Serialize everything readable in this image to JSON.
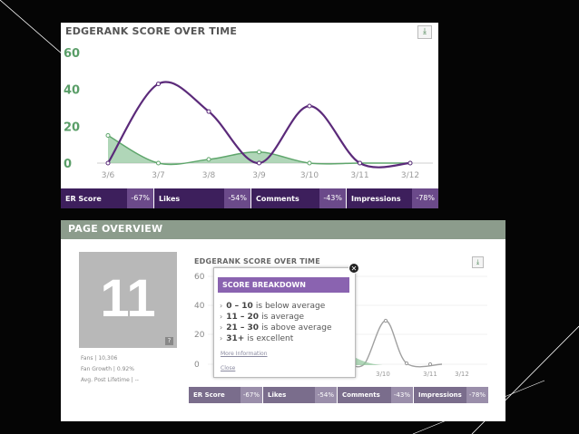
{
  "top_chart": {
    "title": "EDGERANK SCORE OVER TIME",
    "y_ticks": [
      "60",
      "40",
      "20",
      "0"
    ],
    "x_ticks": [
      "3/6",
      "3/7",
      "3/8",
      "3/9",
      "3/10",
      "3/11",
      "3/12"
    ],
    "download_icon": "download-icon",
    "colors": {
      "er_line": "#5b2a7a",
      "engagement_fill": "#8fc49a",
      "engagement_line": "#5fa66c"
    }
  },
  "chart_data": [
    {
      "type": "line",
      "title": "EDGERANK SCORE OVER TIME",
      "x": [
        "3/6",
        "3/7",
        "3/8",
        "3/9",
        "3/10",
        "3/11",
        "3/12"
      ],
      "ylim": [
        0,
        60
      ],
      "series": [
        {
          "values": [
            0,
            43,
            28,
            0,
            31,
            0,
            0
          ]
        },
        {
          "values": [
            15,
            0,
            2,
            6,
            0,
            0,
            0
          ]
        }
      ]
    }
  ],
  "top_stats": [
    {
      "label": "ER Score",
      "value": "-67%"
    },
    {
      "label": "Likes",
      "value": "-54%"
    },
    {
      "label": "Comments",
      "value": "-43%"
    },
    {
      "label": "Impressions",
      "value": "-78%"
    }
  ],
  "overview": {
    "title": "PAGE OVERVIEW",
    "score": "11",
    "score_corner": "?",
    "fans": "Fans | 10,306",
    "growth": "Fan Growth | 0.92%",
    "lifetime": "Avg. Post Lifetime | --",
    "chart_title": "EDGERANK SCORE OVER TIME",
    "y_ticks": [
      "60",
      "40",
      "20",
      "0"
    ],
    "x_ticks": [
      "3/10",
      "3/11",
      "3/12"
    ],
    "download_icon": "download-icon"
  },
  "popup": {
    "title": "SCORE BREAKDOWN",
    "items": [
      {
        "range": "0 – 10",
        "text": "is below average"
      },
      {
        "range": "11 – 20",
        "text": "is average"
      },
      {
        "range": "21 – 30",
        "text": "is above average"
      },
      {
        "range": "31+",
        "text": "is excellent"
      }
    ],
    "more_link": "More Information",
    "close_link": "Close",
    "close_icon": "close-icon"
  },
  "bottom_stats": [
    {
      "label": "ER Score",
      "value": "-67%"
    },
    {
      "label": "Likes",
      "value": "-54%"
    },
    {
      "label": "Comments",
      "value": "-43%"
    },
    {
      "label": "Impressions",
      "value": "-78%"
    }
  ]
}
